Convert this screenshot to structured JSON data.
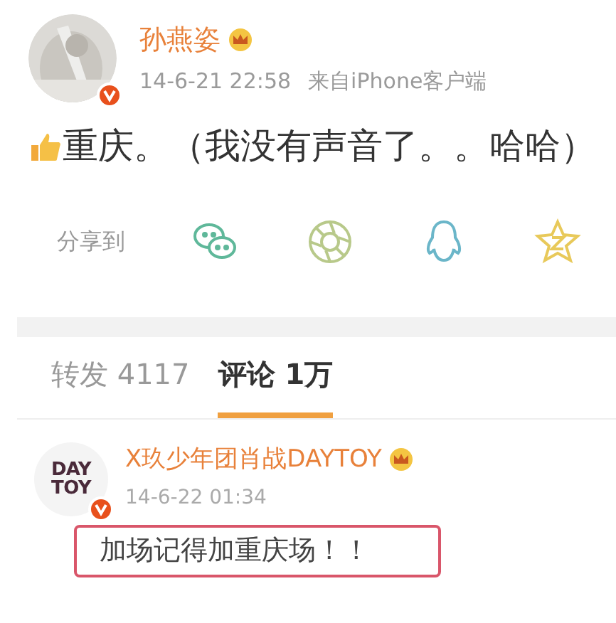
{
  "post": {
    "author": "孙燕姿",
    "verified": true,
    "time": "14-6-21 22:58",
    "source": "来自iPhone客户端",
    "text": "重庆。（我没有声音了。。哈哈）"
  },
  "share": {
    "label": "分享到",
    "targets": [
      {
        "kind": "wechat",
        "color": "#5fb89a"
      },
      {
        "kind": "moments",
        "color": "#b8c98a"
      },
      {
        "kind": "qq",
        "color": "#6bb6c9"
      },
      {
        "kind": "qzone",
        "color": "#e8c95a"
      }
    ]
  },
  "tabs": [
    {
      "label": "转发 4117",
      "selected": false
    },
    {
      "label": "评论 1万",
      "selected": true
    }
  ],
  "comments": [
    {
      "logo": [
        "DAY",
        "TOY"
      ],
      "author": "X玖少年团肖战DAYTOY",
      "verified": true,
      "time": "14-6-22 01:34",
      "text": "加场记得加重庆场！！",
      "highlighted": true
    }
  ]
}
